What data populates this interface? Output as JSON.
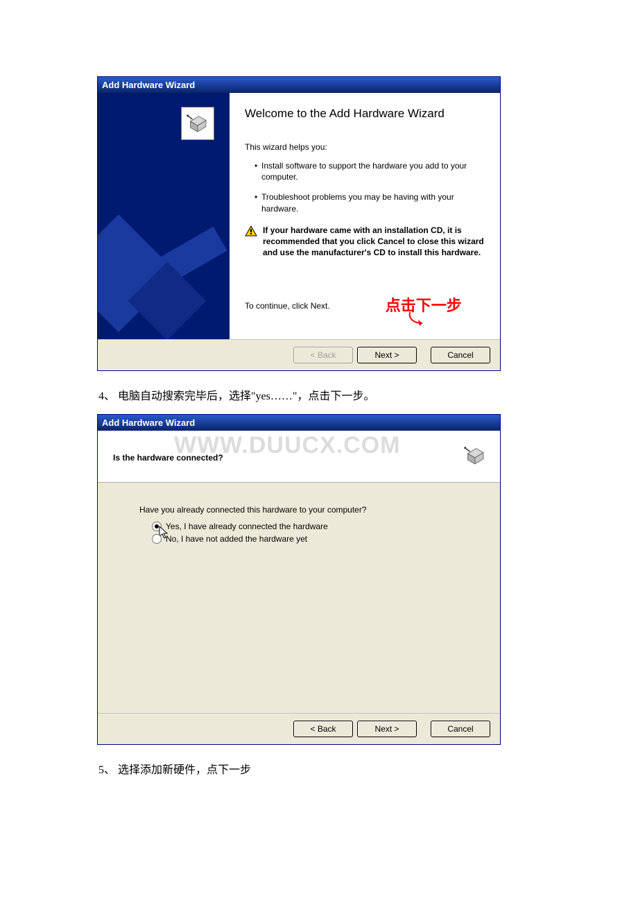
{
  "dialog1": {
    "title": "Add Hardware Wizard",
    "heading": "Welcome to the Add Hardware Wizard",
    "intro": "This wizard helps you:",
    "bullets": [
      "Install software to support the hardware you add to your computer.",
      "Troubleshoot problems you may be having with your hardware."
    ],
    "warning": "If your hardware came with an installation CD, it is recommended that you click Cancel to close this wizard and use the manufacturer's CD to install this hardware.",
    "continue_text": "To continue, click Next.",
    "annotation_cn": "点击下一步",
    "buttons": {
      "back": "< Back",
      "next": "Next >",
      "cancel": "Cancel"
    }
  },
  "instruction4": "4、 电脑自动搜索完毕后，选择\"yes……\"，点击下一步。",
  "dialog2": {
    "title": "Add Hardware Wizard",
    "header_q": "Is the hardware connected?",
    "watermark": "WWW.DUUCX.COM",
    "body_q": "Have you already connected this hardware to your computer?",
    "radio_yes": "Yes, I have already connected the hardware",
    "radio_no": "No, I have not added the hardware yet",
    "buttons": {
      "back": "< Back",
      "next": "Next >",
      "cancel": "Cancel"
    }
  },
  "instruction5": "5、 选择添加新硬件，点下一步"
}
